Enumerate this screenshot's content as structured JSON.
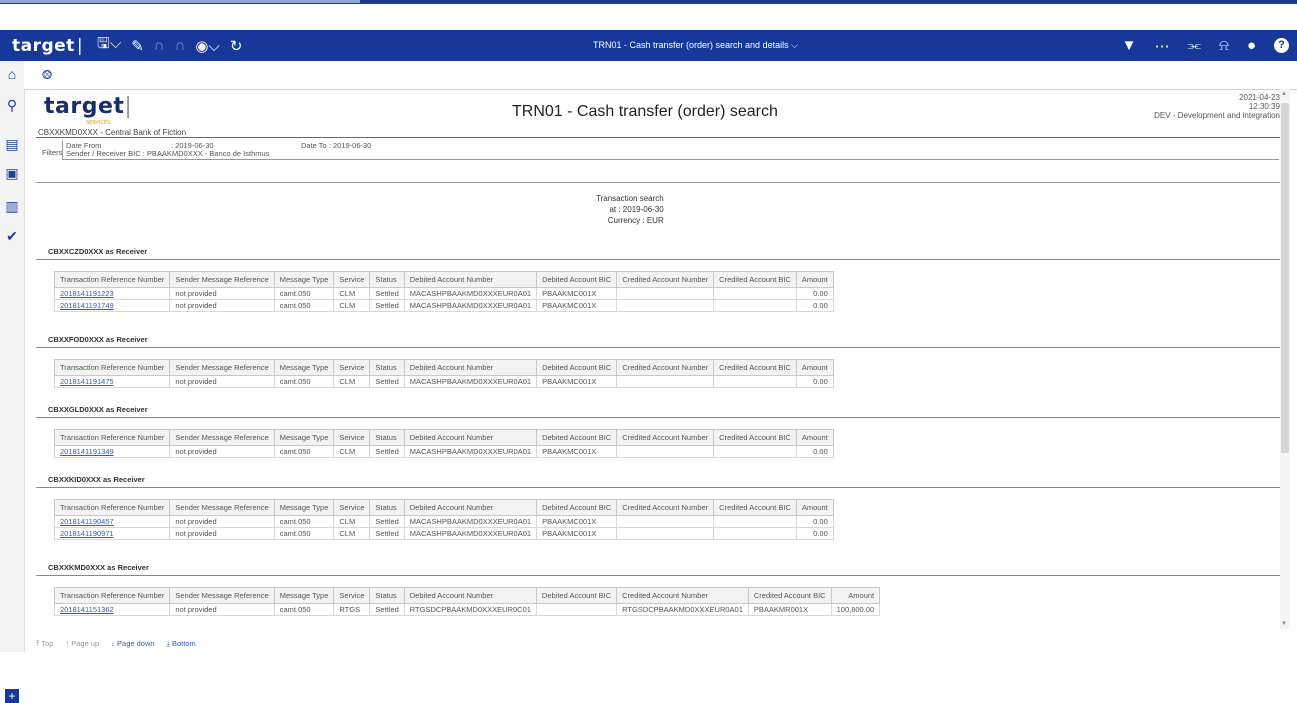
{
  "app": {
    "logo": "target",
    "window_title": "TRN01 - Cash transfer (order) search and details"
  },
  "toolbar": {
    "icons": [
      "save-icon",
      "edit-icon",
      "undo-icon",
      "redo-icon",
      "play-icon",
      "refresh-icon"
    ]
  },
  "header_right": {
    "icons": [
      "filter-icon",
      "more-icon",
      "share-icon",
      "bell-icon",
      "user-icon",
      "help-icon"
    ],
    "help_label": "?"
  },
  "report": {
    "logo": "target",
    "logo_sub": "SERVICES",
    "title": "TRN01 - Cash transfer (order) search",
    "meta_date": "2021-04-23",
    "meta_time": "12:30:39",
    "meta_env": "DEV - Development and integration",
    "bank": "CBXXKMD0XXX - Central Bank of Fiction",
    "filters": {
      "label": "Filters",
      "date_from_label": "Date From",
      "date_from_value": ": 2019-06-30",
      "date_to": "Date To : 2019-06-30",
      "bic": "Sender / Receiver BIC : PBAAKMD0XXX - Banco de Isthmus"
    },
    "summary": {
      "title": "Transaction search",
      "at": "at : 2019-06-30",
      "currency": "Currency : EUR"
    },
    "columns": [
      "Transaction Reference Number",
      "Sender Message Reference",
      "Message Type",
      "Service",
      "Status",
      "Debited Account Number",
      "Debited Account BIC",
      "Credited Account Number",
      "Credited Account BIC",
      "Amount"
    ],
    "sections": [
      {
        "title": "CBXXCZD0XXX as Receiver",
        "rows": [
          [
            "2018141191223",
            "not provided",
            "camt.050",
            "CLM",
            "Settled",
            "MACASHPBAAKMD0XXXEUR0A01",
            "PBAAKMC001X",
            "",
            "",
            "0.00"
          ],
          [
            "2018141191749",
            "not provided",
            "camt.050",
            "CLM",
            "Settled",
            "MACASHPBAAKMD0XXXEUR0A01",
            "PBAAKMC001X",
            "",
            "",
            "0.00"
          ]
        ]
      },
      {
        "title": "CBXXFOD0XXX as Receiver",
        "rows": [
          [
            "2018141191475",
            "not provided",
            "camt.050",
            "CLM",
            "Settled",
            "MACASHPBAAKMD0XXXEUR0A01",
            "PBAAKMC001X",
            "",
            "",
            "0.00"
          ]
        ]
      },
      {
        "title": "CBXXGLD0XXX as Receiver",
        "rows": [
          [
            "2018141191349",
            "not provided",
            "camt.050",
            "CLM",
            "Settled",
            "MACASHPBAAKMD0XXXEUR0A01",
            "PBAAKMC001X",
            "",
            "",
            "0.00"
          ]
        ]
      },
      {
        "title": "CBXXKID0XXX as Receiver",
        "rows": [
          [
            "2018141190457",
            "not provided",
            "camt.050",
            "CLM",
            "Settled",
            "MACASHPBAAKMD0XXXEUR0A01",
            "PBAAKMC001X",
            "",
            "",
            "0.00"
          ],
          [
            "2018141190971",
            "not provided",
            "camt.050",
            "CLM",
            "Settled",
            "MACASHPBAAKMD0XXXEUR0A01",
            "PBAAKMC001X",
            "",
            "",
            "0.00"
          ]
        ]
      },
      {
        "title": "CBXXKMD0XXX as Receiver",
        "rows": [
          [
            "2018141151362",
            "not provided",
            "camt.050",
            "RTGS",
            "Settled",
            "RTGSDCPBAAKMD0XXXEUR0C01",
            "",
            "RTGSDCPBAAKMD0XXXEUR0A01",
            "PBAAKMR001X",
            "100,800.00"
          ]
        ]
      }
    ]
  },
  "bottom_nav": {
    "top": "Top",
    "page_up": "Page up",
    "page_down": "Page down",
    "bottom": "Bottom"
  }
}
